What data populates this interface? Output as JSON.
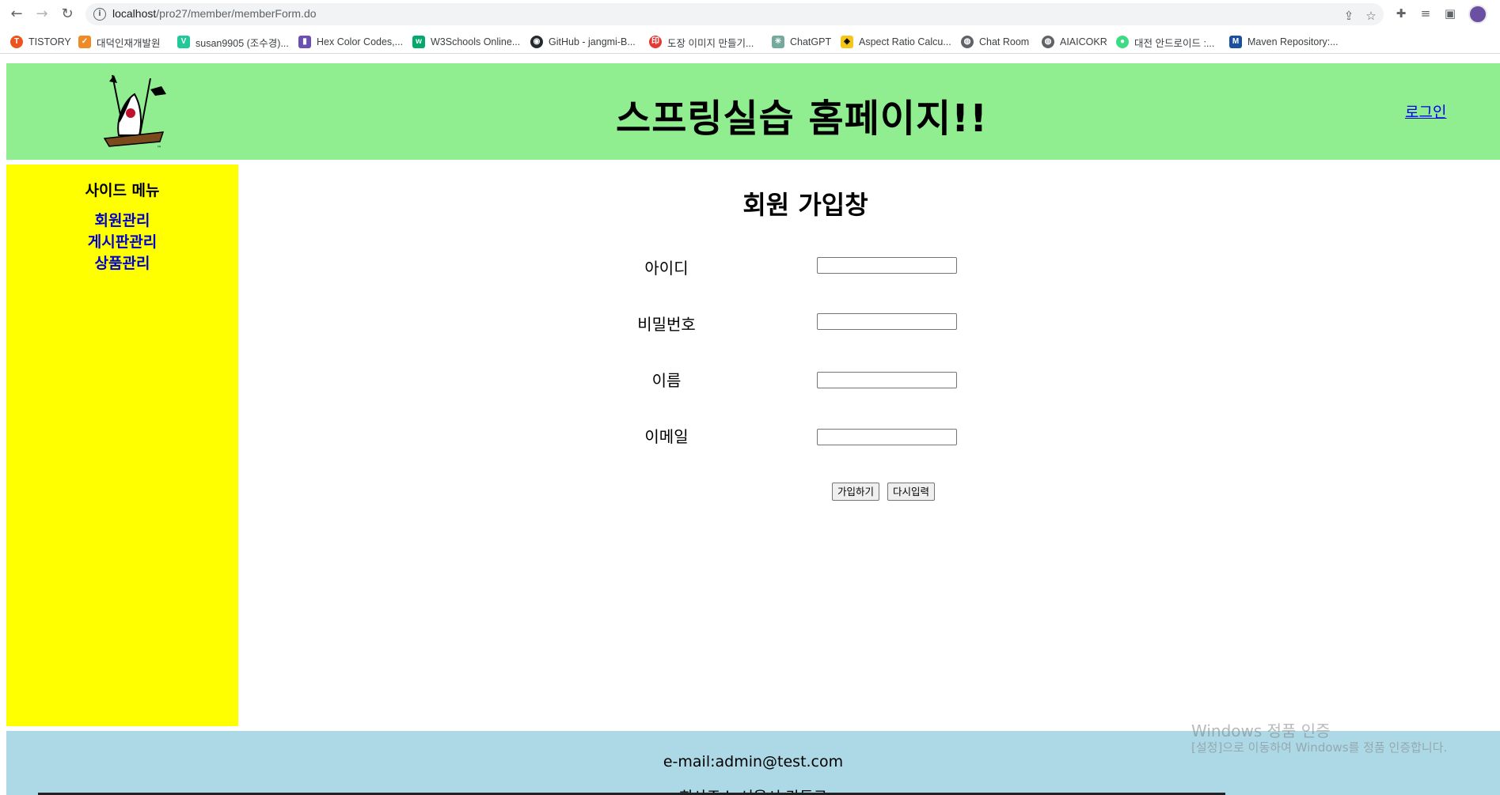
{
  "browser": {
    "url_host": "localhost",
    "url_path": "/pro27/member/memberForm.do",
    "bookmarks": [
      {
        "label": "TISTORY",
        "color": "#eb531f",
        "icon": "T"
      },
      {
        "label": "대덕인재개발원",
        "color": "#f08a24",
        "icon": "✓"
      },
      {
        "label": "susan9905 (조수경)...",
        "color": "#20c997",
        "icon": "V"
      },
      {
        "label": "Hex Color Codes,...",
        "color": "#6c4fb3",
        "icon": "▮"
      },
      {
        "label": "W3Schools Online...",
        "color": "#04aa6d",
        "icon": "w"
      },
      {
        "label": "GitHub - jangmi-B...",
        "color": "#24292f",
        "icon": "◉"
      },
      {
        "label": "도장 이미지 만들기...",
        "color": "#e53935",
        "icon": "印"
      },
      {
        "label": "ChatGPT",
        "color": "#74aa9c",
        "icon": "✳"
      },
      {
        "label": "Aspect Ratio Calcu...",
        "color": "#f5c518",
        "icon": "◈"
      },
      {
        "label": "Chat Room",
        "color": "#5f6368",
        "icon": "◍"
      },
      {
        "label": "AIAICOKR",
        "color": "#5f6368",
        "icon": "◍"
      },
      {
        "label": "대전 안드로이드 :...",
        "color": "#3ddc84",
        "icon": "●"
      },
      {
        "label": "Maven Repository:...",
        "color": "#1a4fa0",
        "icon": "M"
      }
    ]
  },
  "header": {
    "title": "스프링실습 홈페이지!!",
    "login_link": "로그인"
  },
  "sidebar": {
    "title": "사이드 메뉴",
    "items": [
      {
        "label": "회원관리"
      },
      {
        "label": "게시판관리"
      },
      {
        "label": "상품관리"
      }
    ]
  },
  "form": {
    "title": "회원 가입창",
    "fields": [
      {
        "label": "아이디",
        "value": ""
      },
      {
        "label": "비밀번호",
        "value": ""
      },
      {
        "label": "이름",
        "value": ""
      },
      {
        "label": "이메일",
        "value": ""
      }
    ],
    "submit_label": "가입하기",
    "reset_label": "다시입력"
  },
  "footer": {
    "email": "e-mail:admin@test.com",
    "address_partial": "회사주소:서울시 강동구"
  },
  "watermark": {
    "title": "Windows 정품 인증",
    "subtitle": "[설정]으로 이동하여 Windows를 정품 인증합니다."
  }
}
